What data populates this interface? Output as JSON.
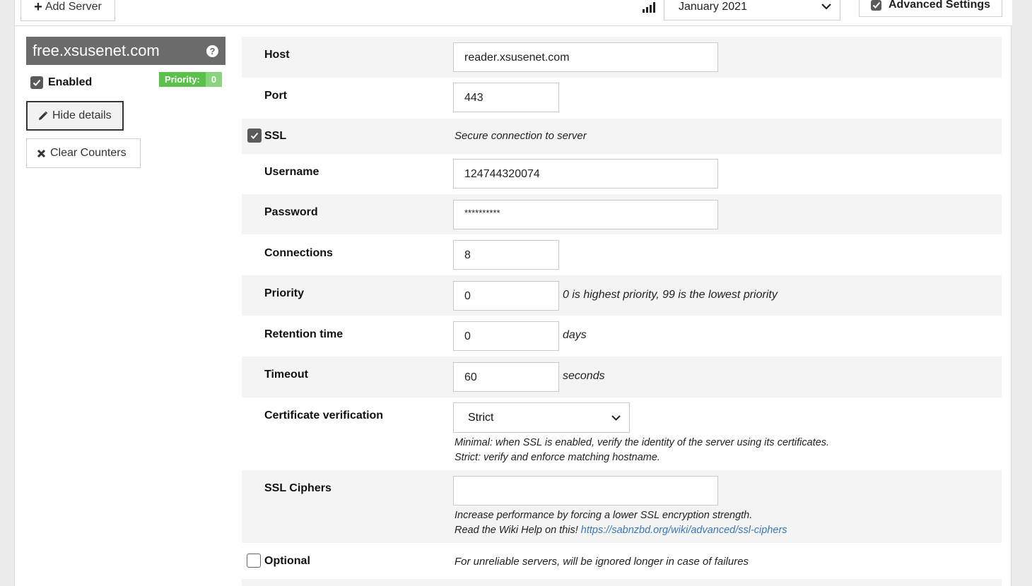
{
  "toolbar": {
    "add_server_label": "Add Server",
    "month_selected": "January 2021",
    "advanced_settings_label": "Advanced Settings",
    "advanced_settings_checked": true
  },
  "server": {
    "name": "free.xsusenet.com",
    "enabled_label": "Enabled",
    "enabled": true,
    "priority_label": "Priority:",
    "priority_value": "0",
    "hide_details_label": "Hide details",
    "clear_counters_label": "Clear Counters"
  },
  "fields": {
    "host": {
      "label": "Host",
      "value": "reader.xsusenet.com"
    },
    "port": {
      "label": "Port",
      "value": "443"
    },
    "ssl": {
      "label": "SSL",
      "checked": true,
      "hint": "Secure connection to server"
    },
    "username": {
      "label": "Username",
      "value": "124744320074"
    },
    "password": {
      "label": "Password",
      "value": "**********"
    },
    "connections": {
      "label": "Connections",
      "value": "8"
    },
    "priority": {
      "label": "Priority",
      "value": "0",
      "hint": "0 is highest priority, 99 is the lowest priority"
    },
    "retention": {
      "label": "Retention time",
      "value": "0",
      "hint": "days"
    },
    "timeout": {
      "label": "Timeout",
      "value": "60",
      "hint": "seconds"
    },
    "cert_verification": {
      "label": "Certificate verification",
      "selected": "Strict",
      "hint_line1": "Minimal: when SSL is enabled, verify the identity of the server using its certificates.",
      "hint_line2": "Strict: verify and enforce matching hostname."
    },
    "ssl_ciphers": {
      "label": "SSL Ciphers",
      "value": "",
      "hint_line1": "Increase performance by forcing a lower SSL encryption strength.",
      "hint_line2_prefix": "Read the Wiki Help on this!",
      "hint_link": "https://sabnzbd.org/wiki/advanced/ssl-ciphers"
    },
    "optional": {
      "label": "Optional",
      "checked": false,
      "hint": "For unreliable servers, will be ignored longer in case of failures"
    }
  },
  "colors": {
    "priority_label_bg": "#5cc04d",
    "priority_value_bg": "#8bd47f",
    "server_header_bg": "#6b6b6b",
    "link": "#3a78b4"
  },
  "icons": [
    "plus-icon",
    "signal-icon",
    "chevron-down-icon",
    "check-icon",
    "help-icon",
    "pencil-icon",
    "x-icon"
  ]
}
